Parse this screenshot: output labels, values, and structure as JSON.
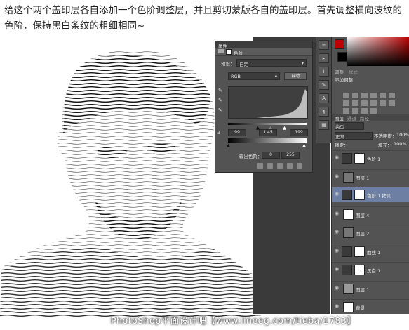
{
  "caption": "给这个两个盖印层各自添加一个色阶调整层，并且剪切蒙版各自的盖印层。首先调整横向波纹的色阶，保持黑白条纹的粗细相同~",
  "watermark": "PhotoShop平面设计吧【www.lineeg.com/tieba/1783】",
  "properties_panel": {
    "title": "属性",
    "tab": "色阶",
    "preset_label": "预设：",
    "preset_value": "自定",
    "channel_value": "RGB",
    "auto_button": "自动",
    "input_black": "99",
    "input_gamma": "1.45",
    "input_white": "199",
    "output_label": "输出色阶：",
    "output_black": "0",
    "output_white": "255"
  },
  "adjustments_panel": {
    "tabs": [
      "调整",
      "样式"
    ],
    "header": "添加调整"
  },
  "layers_panel": {
    "tabs": [
      "图层",
      "通道",
      "路径"
    ],
    "kind_label": "类型",
    "blend_mode": "正常",
    "opacity_label": "不透明度：",
    "opacity_value": "100%",
    "lock_label": "锁定：",
    "fill_label": "填充：",
    "fill_value": "100%",
    "layers": [
      {
        "name": "色阶 1",
        "type": "adjustment",
        "selected": false
      },
      {
        "name": "图层 1",
        "type": "dark",
        "selected": false
      },
      {
        "name": "色阶 1 拷贝",
        "type": "adjustment",
        "selected": true
      },
      {
        "name": "图层 4",
        "type": "white",
        "selected": false
      },
      {
        "name": "图层 2",
        "type": "dark",
        "selected": false
      },
      {
        "name": "曲线 1",
        "type": "adjustment",
        "selected": false
      },
      {
        "name": "黑白 1",
        "type": "adjustment",
        "selected": false
      },
      {
        "name": "图层 1",
        "type": "photo",
        "selected": false
      },
      {
        "name": "背景",
        "type": "white",
        "selected": false
      }
    ]
  },
  "colors": {
    "ps_panel": "#535353",
    "ps_dark": "#3a3a3a",
    "selected_layer": "#6d7fa3",
    "accent_red": "#c00000"
  }
}
